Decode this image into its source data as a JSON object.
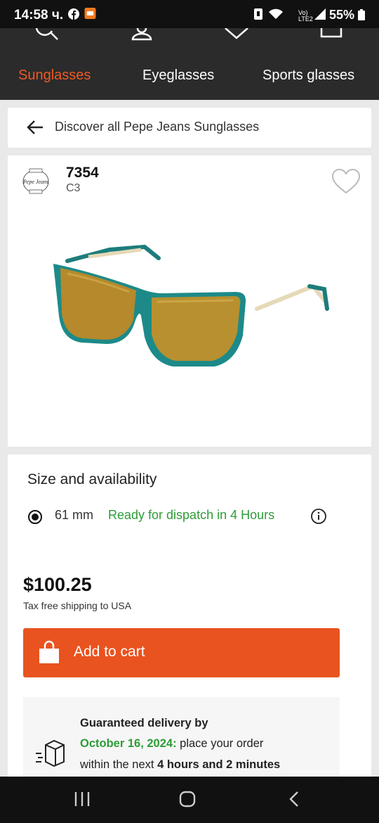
{
  "status_bar": {
    "time": "14:58 ч.",
    "battery": "55%"
  },
  "nav": {
    "icons": [
      "search-icon",
      "account-icon",
      "heart-icon",
      "bag-icon"
    ],
    "tabs": [
      {
        "label": "Sunglasses",
        "active": true
      },
      {
        "label": "Eyeglasses",
        "active": false
      },
      {
        "label": "Sports glasses",
        "active": false
      }
    ]
  },
  "breadcrumb": {
    "text": "Discover all Pepe Jeans Sunglasses"
  },
  "product": {
    "brand_logo_text": "Pepe Jeans",
    "model": "7354",
    "color_code": "C3",
    "favorite": false
  },
  "size": {
    "title": "Size and availability",
    "options": [
      {
        "value": "61 mm",
        "availability": "Ready for dispatch in 4 Hours",
        "selected": true
      }
    ]
  },
  "pricing": {
    "price": "$100.25",
    "shipping_note": "Tax free shipping to USA",
    "add_to_cart": "Add to cart"
  },
  "delivery": {
    "line1_green": "Guaranteed delivery by",
    "line2_green": "October 16, 2024:",
    "line2_rest": " place your order",
    "line3_rest": "within the next ",
    "line3_bold": "4 hours and 2 minutes"
  },
  "colors": {
    "accent": "#ef5a24",
    "cta": "#e9531f",
    "success": "#2e9c37",
    "nav_bg": "#2b2b2b"
  }
}
